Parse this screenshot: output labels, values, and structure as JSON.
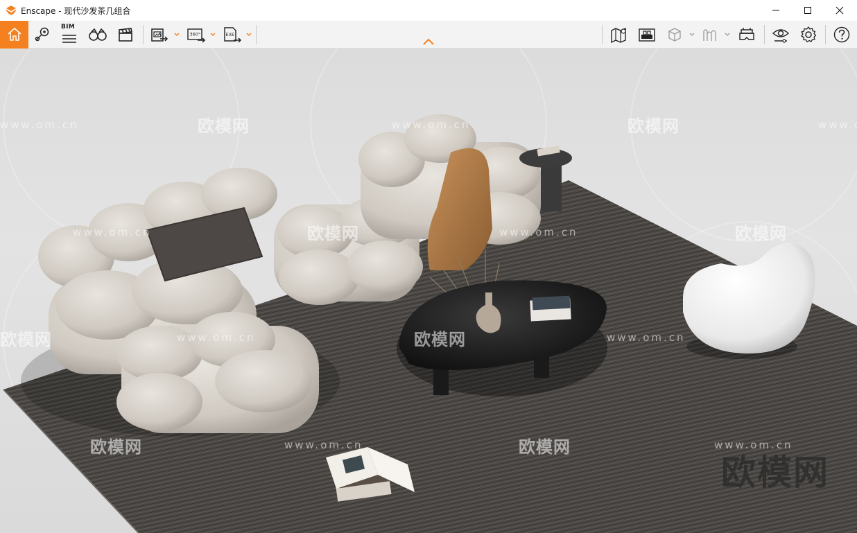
{
  "window": {
    "app_name": "Enscape",
    "title": "Enscape - 现代沙发茶几组合",
    "controls": {
      "minimize": "minimize",
      "maximize": "maximize",
      "close": "close"
    }
  },
  "toolbar": {
    "bim_label": "BIM",
    "left_tools": [
      {
        "name": "home",
        "icon": "home-icon",
        "active": true
      },
      {
        "name": "views",
        "icon": "location-pin-icon"
      },
      {
        "name": "bim",
        "icon": "bim-icon"
      },
      {
        "name": "compare",
        "icon": "binoculars-icon"
      },
      {
        "name": "video",
        "icon": "clapperboard-icon"
      }
    ],
    "export_tools": [
      {
        "name": "screenshot-export",
        "icon": "image-export-icon"
      },
      {
        "name": "panorama-export",
        "icon": "panorama-360-icon",
        "badge": "360°"
      },
      {
        "name": "exe-export",
        "icon": "exe-export-icon",
        "badge": "EXE"
      }
    ],
    "right_tools": [
      {
        "name": "map",
        "icon": "map-icon"
      },
      {
        "name": "asset-library",
        "icon": "asset-library-icon"
      },
      {
        "name": "section-box",
        "icon": "cube-icon"
      },
      {
        "name": "silhouette",
        "icon": "silhouette-icon"
      },
      {
        "name": "vr-headset",
        "icon": "vr-headset-icon"
      },
      {
        "name": "visual-settings",
        "icon": "eye-icon"
      },
      {
        "name": "settings",
        "icon": "gear-icon"
      },
      {
        "name": "help",
        "icon": "help-icon"
      }
    ],
    "accent_color": "#f5801f"
  },
  "viewport": {
    "watermark_url": "www.om.cn",
    "watermark_logo": "欧模网",
    "watermark_big": "欧模网"
  }
}
